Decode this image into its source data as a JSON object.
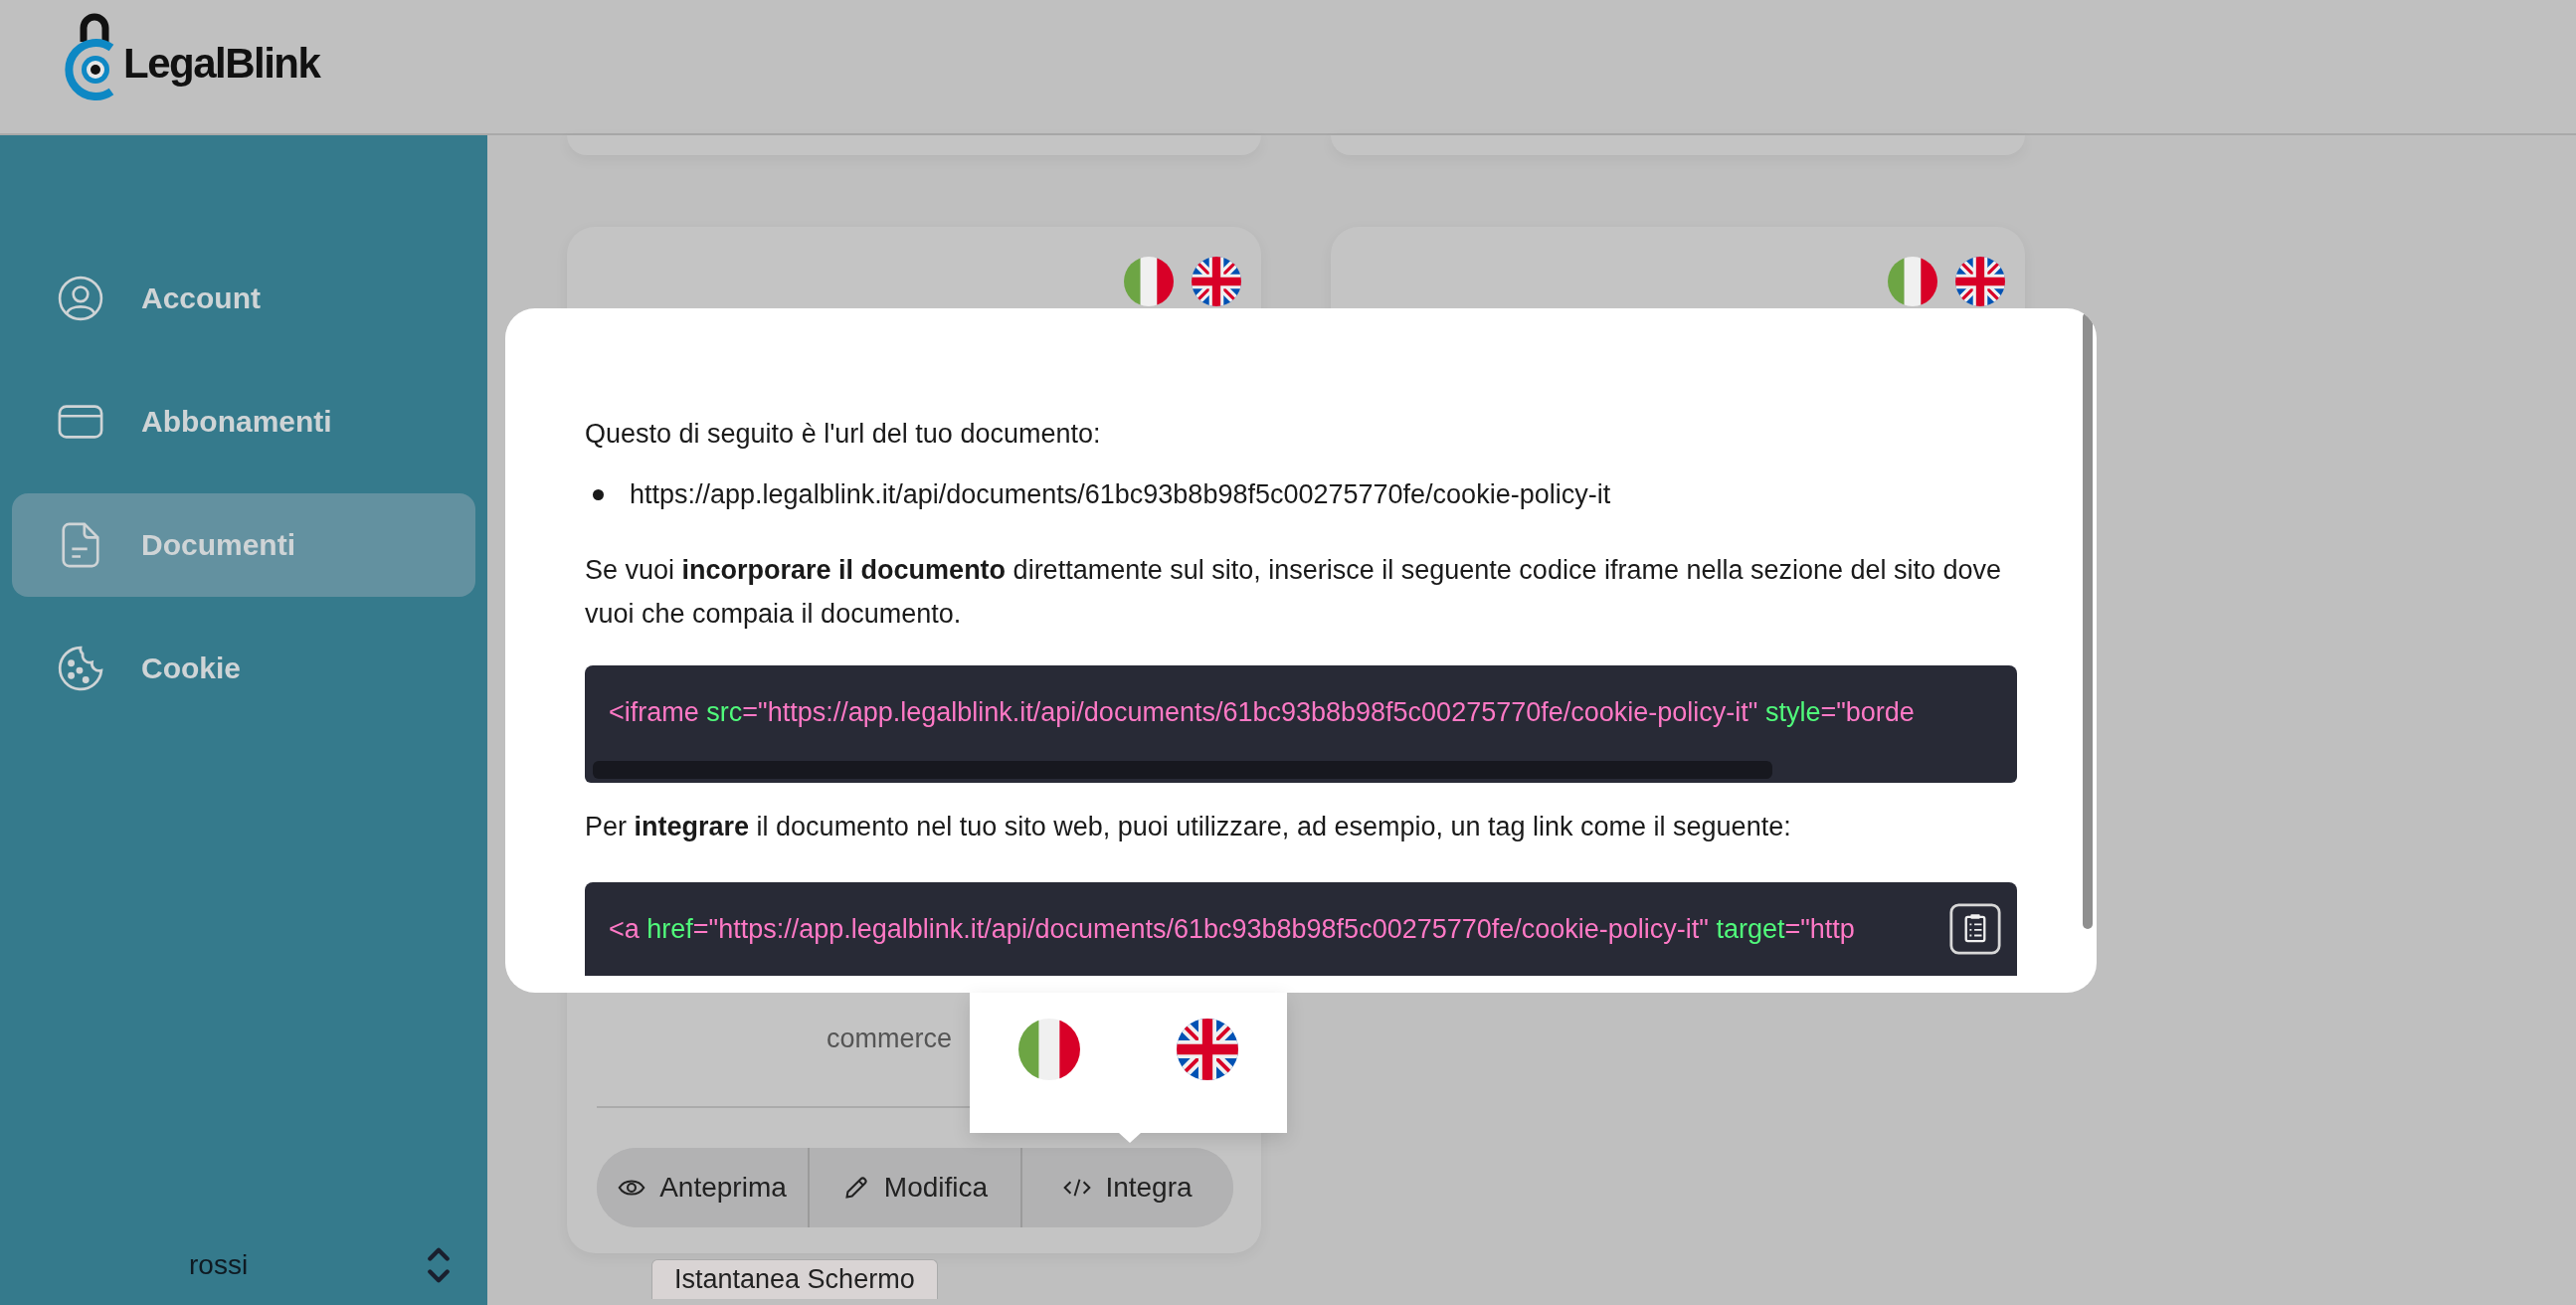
{
  "header": {
    "logo_text": "LegalBlink"
  },
  "sidebar": {
    "items": [
      {
        "label": "Account",
        "selected": false
      },
      {
        "label": "Abbonamenti",
        "selected": false
      },
      {
        "label": "Documenti",
        "selected": true
      },
      {
        "label": "Cookie",
        "selected": false
      }
    ],
    "user": {
      "name": "rossi"
    }
  },
  "cards": [
    {
      "flags": [
        {
          "kind": "italy"
        },
        {
          "kind": "uk"
        }
      ],
      "description": "commerce",
      "actions": [
        {
          "label": "Anteprima"
        },
        {
          "label": "Modifica"
        },
        {
          "label": "Integra"
        }
      ]
    },
    {
      "flags": [
        {
          "kind": "italy"
        },
        {
          "kind": "uk"
        }
      ]
    }
  ],
  "modal": {
    "intro": "Questo di seguito è l'url del tuo documento:",
    "urls": [
      "https://app.legalblink.it/api/documents/61bc93b8b98f5c00275770fe/cookie-policy-it"
    ],
    "embed_text": "Se vuoi **incorporare il documento** direttamente sul sito, inserisce il seguente codice iframe nella sezione del sito dove vuoi che compaia il documento.",
    "iframe_code": [
      {
        "kind": "tag",
        "text": "<iframe"
      },
      {
        "kind": "attr",
        "text": " src"
      },
      {
        "kind": "value",
        "text": "=\"https://app.legalblink.it/api/documents/61bc93b8b98f5c00275770fe/cookie-policy-it\""
      },
      {
        "kind": "attr",
        "text": " style"
      },
      {
        "kind": "value",
        "text": "=\"borde"
      }
    ],
    "link_text": "Per **integrare** il documento nel tuo sito web, puoi utilizzare, ad esempio, un tag link come il seguente:",
    "link_code": [
      {
        "kind": "tag",
        "text": "<a"
      },
      {
        "kind": "attr",
        "text": " href"
      },
      {
        "kind": "value",
        "text": "=\"https://app.legalblink.it/api/documents/61bc93b8b98f5c00275770fe/cookie-policy-it\""
      },
      {
        "kind": "attr",
        "text": " target"
      },
      {
        "kind": "value",
        "text": "=\"http"
      }
    ]
  },
  "language_popover": {
    "flags": [
      {
        "kind": "italy"
      },
      {
        "kind": "uk"
      }
    ]
  },
  "screenshot_button": {
    "label": "Istantanea Schermo"
  }
}
